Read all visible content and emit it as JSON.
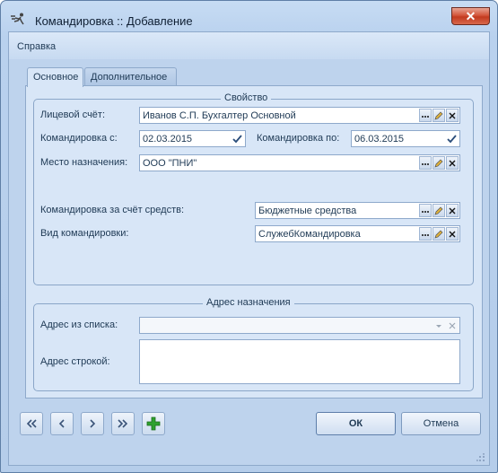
{
  "window": {
    "title": "Командировка :: Добавление",
    "close_glyph": "✕"
  },
  "menu": {
    "help": "Справка"
  },
  "tabs": [
    {
      "label": "Основное",
      "active": true
    },
    {
      "label": "Дополнительное",
      "active": false
    }
  ],
  "property_group": {
    "title": "Свойство",
    "account_label": "Лицевой счёт:",
    "account_value": "Иванов С.П. Бухгалтер Основной",
    "trip_from_label": "Командировка с:",
    "trip_from_value": "02.03.2015",
    "trip_to_label": "Командировка по:",
    "trip_to_value": "06.03.2015",
    "destination_label": "Место назначения:",
    "destination_value": "ООО \"ПНИ\"",
    "funds_label": "Командировка за счёт средств:",
    "funds_value": "Бюджетные средства",
    "trip_type_label": "Вид командировки:",
    "trip_type_value": "СлужебКомандировка"
  },
  "address_group": {
    "title": "Адрес назначения",
    "list_label": "Адрес из списка:",
    "list_value": "",
    "string_label": "Адрес строкой:",
    "string_value": ""
  },
  "footer": {
    "ok_label": "ОК",
    "cancel_label": "Отмена"
  },
  "icons": {
    "app": "person-walking-icon",
    "ellipsis": "ellipsis-icon",
    "edit": "pencil-icon",
    "clear": "close-icon",
    "check": "checkmark-icon",
    "dropdown": "dropdown-arrow-icon",
    "first": "double-chevron-left-icon",
    "prev": "chevron-left-icon",
    "next": "chevron-right-icon",
    "last": "double-chevron-right-icon",
    "add": "plus-icon"
  },
  "colors": {
    "window_bg": "#bed3ed",
    "panel_bg": "#d8e6f7",
    "border": "#8ea9cb",
    "add_green": "#2fa12f"
  }
}
